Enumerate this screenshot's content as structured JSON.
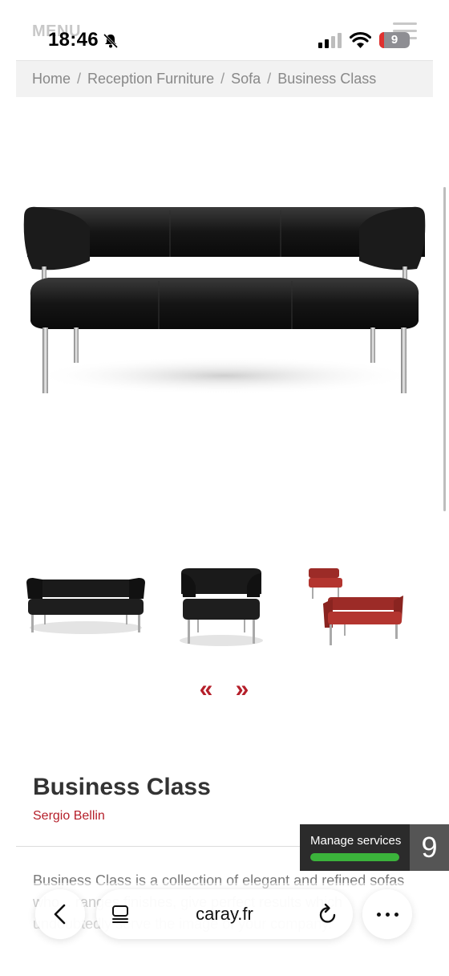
{
  "status_bar": {
    "time": "18:46",
    "battery": "9",
    "menu_text": "MENU"
  },
  "breadcrumb": {
    "items": [
      "Home",
      "Reception Furniture",
      "Sofa",
      "Business Class"
    ],
    "separator": "/"
  },
  "gallery": {
    "thumbnails": [
      "sofa-black",
      "armchair-black",
      "set-red"
    ],
    "prev_label": "«",
    "next_label": "»"
  },
  "product": {
    "title": "Business Class",
    "designer": "Sergio Bellin",
    "description": "Business Class is a collection of elegant and refined sofas who... ranges finishes, give perfect results which undoubtedly serve the image of your company."
  },
  "manage_services": {
    "label": "Manage services",
    "count": "9"
  },
  "browser": {
    "url": "caray.fr"
  },
  "colors": {
    "accent": "#b51f2a",
    "status_green": "#3bb33b",
    "sofa_black": "#1a1a1a",
    "sofa_red": "#9c2b27"
  }
}
